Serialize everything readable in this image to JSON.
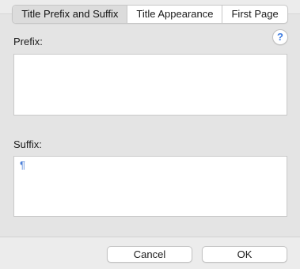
{
  "tabs": [
    {
      "label": "Title Prefix and Suffix",
      "selected": true
    },
    {
      "label": "Title Appearance",
      "selected": false
    },
    {
      "label": "First Page",
      "selected": false
    }
  ],
  "help": {
    "glyph": "?"
  },
  "prefix": {
    "label": "Prefix:",
    "value": ""
  },
  "suffix": {
    "label": "Suffix:",
    "value": "¶"
  },
  "buttons": {
    "cancel": "Cancel",
    "ok": "OK"
  }
}
